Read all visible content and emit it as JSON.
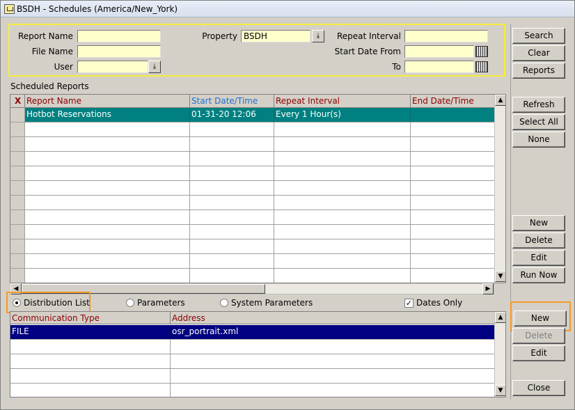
{
  "window": {
    "title": "BSDH - Schedules (America/New_York)"
  },
  "filters": {
    "report_name_label": "Report Name",
    "file_name_label": "File Name",
    "user_label": "User",
    "property_label": "Property",
    "property_value": "BSDH",
    "repeat_interval_label": "Repeat Interval",
    "start_date_from_label": "Start Date From",
    "to_label": "To"
  },
  "buttons": {
    "search": "Search",
    "clear": "Clear",
    "reports": "Reports",
    "refresh": "Refresh",
    "select_all": "Select All",
    "none": "None",
    "new": "New",
    "delete": "Delete",
    "edit": "Edit",
    "run_now": "Run Now",
    "dist_new": "New",
    "dist_delete": "Delete",
    "dist_edit": "Edit",
    "close": "Close"
  },
  "scheduled": {
    "section_label": "Scheduled Reports",
    "columns": [
      "X",
      "Report Name",
      "Start Date/Time",
      "Repeat Interval",
      "End Date/Time"
    ],
    "rows": [
      {
        "report_name": "Hotbot Reservations",
        "start": "01-31-20 12:06",
        "repeat": "Every 1 Hour(s)",
        "end": ""
      }
    ]
  },
  "tabs": {
    "distribution_list": "Distribution List",
    "parameters": "Parameters",
    "system_parameters": "System Parameters",
    "dates_only": "Dates Only",
    "selected": "distribution_list",
    "dates_only_checked": true
  },
  "distribution": {
    "columns": [
      "Communication Type",
      "Address"
    ],
    "rows": [
      {
        "type": "FILE",
        "address": "osr_portrait.xml"
      }
    ]
  },
  "colors": {
    "selected_row_teal": "#008080",
    "selected_row_navy": "#000080",
    "header_text_red": "#8b0000",
    "header_text_blue": "#1f6fd1",
    "highlight_orange": "#f49a2a",
    "highlight_yellow": "#f5ed3a"
  }
}
